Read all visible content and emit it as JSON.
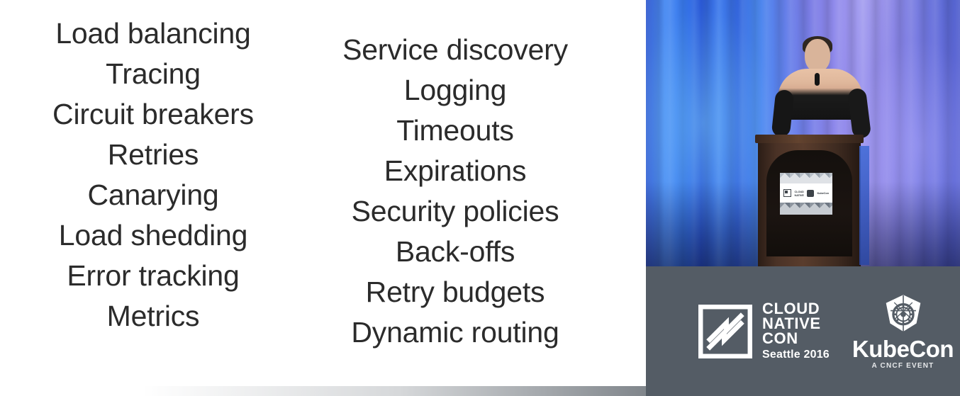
{
  "slide": {
    "left_column": [
      "Load balancing",
      "Tracing",
      "Circuit breakers",
      "Retries",
      "Canarying",
      "Load shedding",
      "Error tracking",
      "Metrics"
    ],
    "right_column": [
      "Service discovery",
      "Logging",
      "Timeouts",
      "Expirations",
      "Security policies",
      "Back-offs",
      "Retry budgets",
      "Dynamic routing"
    ],
    "text_color": "#2b2b2b",
    "background_color": "#ffffff"
  },
  "video": {
    "scene": "speaker-at-podium",
    "backdrop": "blue-purple-lit-curtain",
    "podium_sign": {
      "left_logo": "cncf-mark-icon",
      "left_text": "CLOUD NATIVE CON",
      "right_logo": "kubernetes-helm-icon",
      "right_text": "KubeCon"
    }
  },
  "logo_bar": {
    "background_color": "#545c65",
    "cncf": {
      "mark": "cncf-mark-icon",
      "line1": "CLOUD",
      "line2": "NATIVE",
      "line3": "CON",
      "location_year": "Seattle 2016"
    },
    "kubecon": {
      "mark": "kubernetes-helm-icon",
      "name": "KubeCon",
      "tagline": "A CNCF EVENT"
    }
  }
}
